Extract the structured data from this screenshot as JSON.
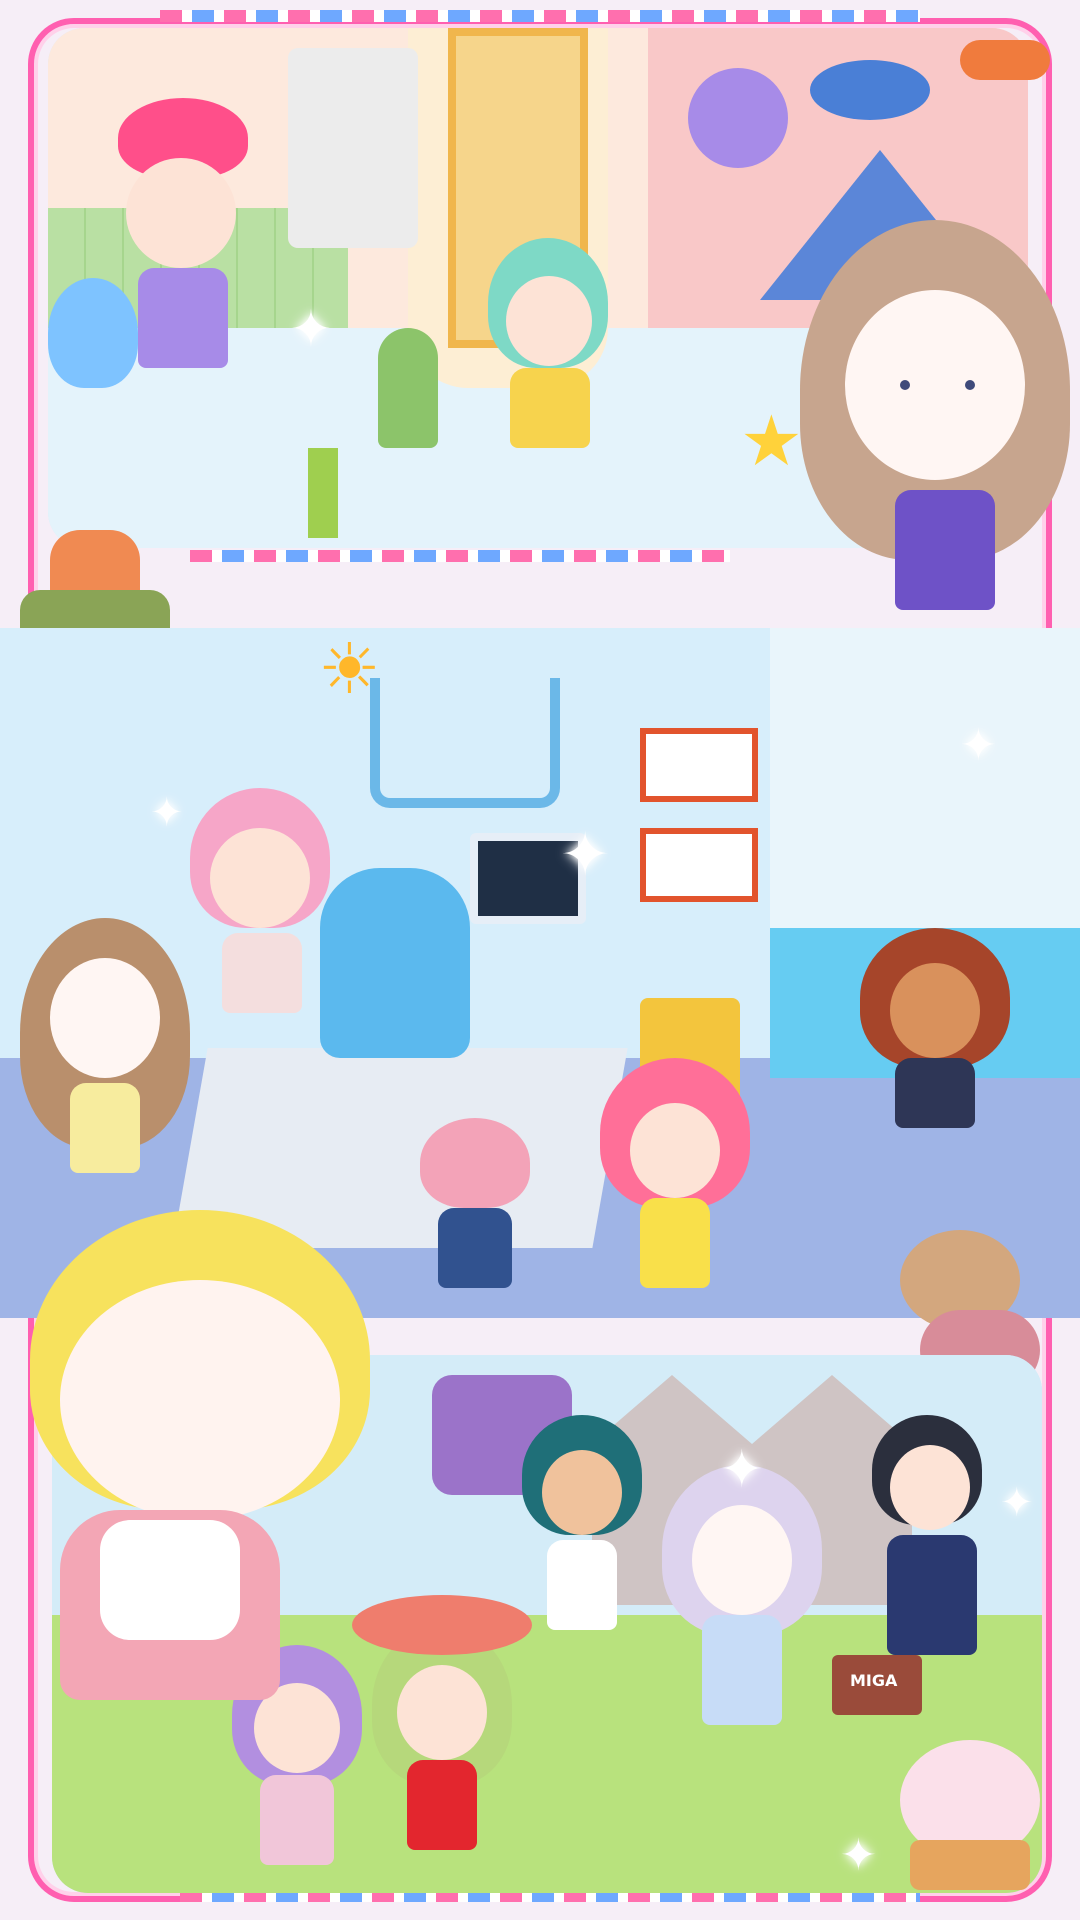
{
  "scenes": {
    "top": {
      "theme": "dim sum restaurant"
    },
    "middle": {
      "theme": "dental clinic"
    },
    "bottom": {
      "theme": "garden party"
    }
  },
  "stickers": {
    "sign_label": "MIGA"
  },
  "colors": {
    "frame": "#ff5fb0",
    "stripe_pink": "#ff6fae",
    "stripe_blue": "#6ea8ff"
  },
  "icons": [
    "sparkle-icon",
    "star-icon",
    "sun-icon",
    "ufo-icon",
    "airplane-icon",
    "toaster-icon",
    "teddy-bear-icon",
    "teapot-icon"
  ]
}
